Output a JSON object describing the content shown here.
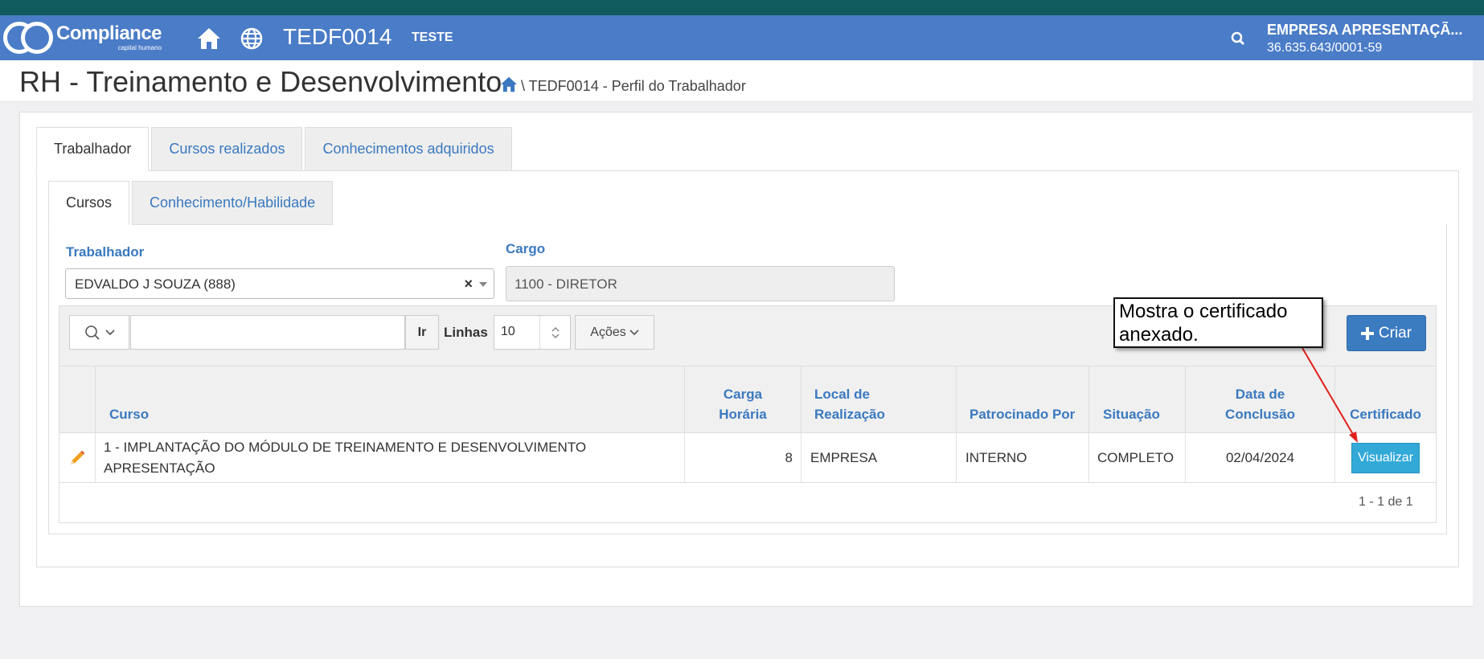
{
  "navbar": {
    "logo_main": "Compliance",
    "logo_sub": "capital humano",
    "page_code": "TEDF0014",
    "env_label": "TESTE",
    "company_name": "EMPRESA APRESENTAÇÃ...",
    "company_cnpj": "36.635.643/0001-59"
  },
  "header": {
    "title": "RH - Treinamento e Desenvolvimento",
    "breadcrumb": "\\ TEDF0014 - Perfil do Trabalhador"
  },
  "tabs_outer": [
    "Trabalhador",
    "Cursos realizados",
    "Conhecimentos adquiridos"
  ],
  "tabs_inner": [
    "Cursos",
    "Conhecimento/Habilidade"
  ],
  "form": {
    "worker_label": "Trabalhador",
    "worker_value": "EDVALDO J SOUZA (888)",
    "clear_symbol": "×",
    "cargo_label": "Cargo",
    "cargo_value": "1100 - DIRETOR"
  },
  "toolbar": {
    "go_label": "Ir",
    "rows_label": "Linhas",
    "rows_value": "10",
    "actions_label": "Ações",
    "create_label": "Criar"
  },
  "table": {
    "headers": {
      "curso": "Curso",
      "carga": "Carga Horária",
      "local": "Local de Realização",
      "patrocinado": "Patrocinado Por",
      "situacao": "Situação",
      "data": "Data de Conclusão",
      "certificado": "Certificado"
    },
    "rows": [
      {
        "curso": "1 - IMPLANTAÇÃO DO MÓDULO DE TREINAMENTO E DESENVOLVIMENTO APRESENTAÇÃO",
        "carga": "8",
        "local": "EMPRESA",
        "patrocinado": "INTERNO",
        "situacao": "COMPLETO",
        "data": "02/04/2024",
        "certificado_btn": "Visualizar"
      }
    ],
    "pagination": "1 - 1 de 1"
  },
  "annotation": {
    "text": "Mostra o certificado anexado."
  },
  "colors": {
    "navbar": "#4a7cc7",
    "top_strip": "#0f5b5e",
    "link": "#3a79c0",
    "create_button": "#3b7bc0",
    "view_button": "#33a9d8",
    "arrow": "#e0201c"
  },
  "icons": [
    "home-icon",
    "globe-icon",
    "search-icon",
    "chevron-down-icon",
    "spinner-arrows-icon",
    "plus-icon",
    "pencil-icon"
  ]
}
